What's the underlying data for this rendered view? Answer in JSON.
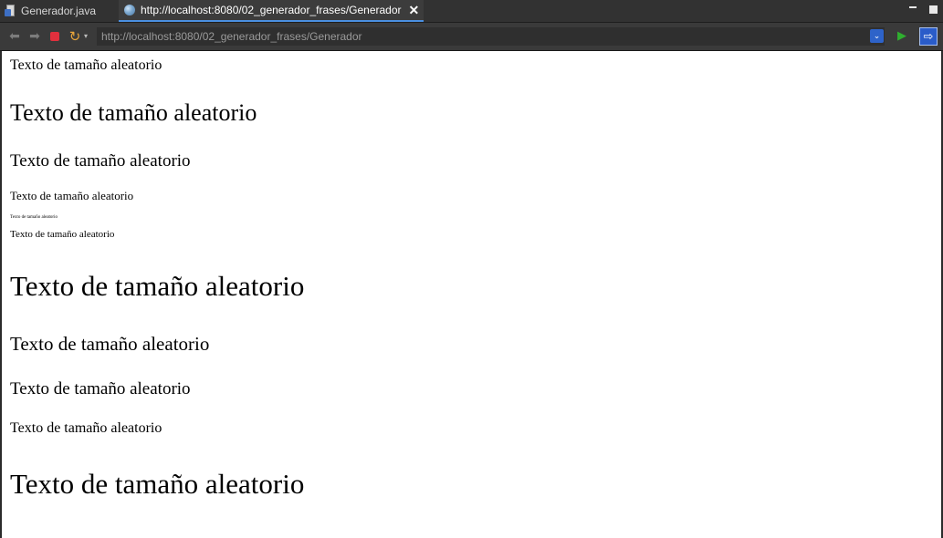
{
  "tabs": [
    {
      "label": "Generador.java"
    },
    {
      "label": "http://localhost:8080/02_generador_frases/Generador"
    }
  ],
  "toolbar": {
    "url": "http://localhost:8080/02_generador_frases/Generador",
    "icons": [
      "back-icon",
      "forward-icon",
      "stop-icon",
      "refresh-icon",
      "url-dropdown-icon",
      "go-icon",
      "open-external-browser-icon"
    ]
  },
  "colors": {
    "stop": "#e0303d",
    "refresh": "#e8a43a",
    "go": "#2fae2f",
    "active_tab_underline": "#4a8fe0"
  },
  "content": {
    "lines": [
      {
        "text": "Texto de tamaño aleatorio"
      },
      {
        "text": "Texto de tamaño aleatorio"
      },
      {
        "text": "Texto de tamaño aleatorio"
      },
      {
        "text": "Texto de tamaño aleatorio"
      },
      {
        "text": "Texto de tamaño aleatorio"
      },
      {
        "text": "Texto de tamaño aleatorio"
      },
      {
        "text": "Texto de tamaño aleatorio"
      },
      {
        "text": "Texto de tamaño aleatorio"
      },
      {
        "text": "Texto de tamaño aleatorio"
      },
      {
        "text": "Texto de tamaño aleatorio"
      },
      {
        "text": "Texto de tamaño aleatorio"
      }
    ]
  }
}
